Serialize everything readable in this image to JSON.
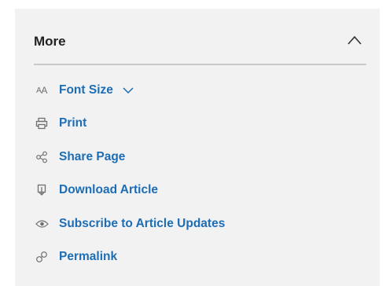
{
  "panel": {
    "title": "More",
    "toggle_icon": "chevron-up-icon",
    "accent_color": "#1d6db5",
    "divider_color": "#c9c9c9"
  },
  "menu": {
    "items": [
      {
        "id": "font-size",
        "label": "Font Size",
        "icon": "font-size-icon",
        "has_dropdown": true
      },
      {
        "id": "print",
        "label": "Print",
        "icon": "printer-icon"
      },
      {
        "id": "share-page",
        "label": "Share Page",
        "icon": "share-icon"
      },
      {
        "id": "download-article",
        "label": "Download Article",
        "icon": "download-icon"
      },
      {
        "id": "subscribe",
        "label": "Subscribe to Article Updates",
        "icon": "eye-icon"
      },
      {
        "id": "permalink",
        "label": "Permalink",
        "icon": "link-icon"
      }
    ]
  }
}
